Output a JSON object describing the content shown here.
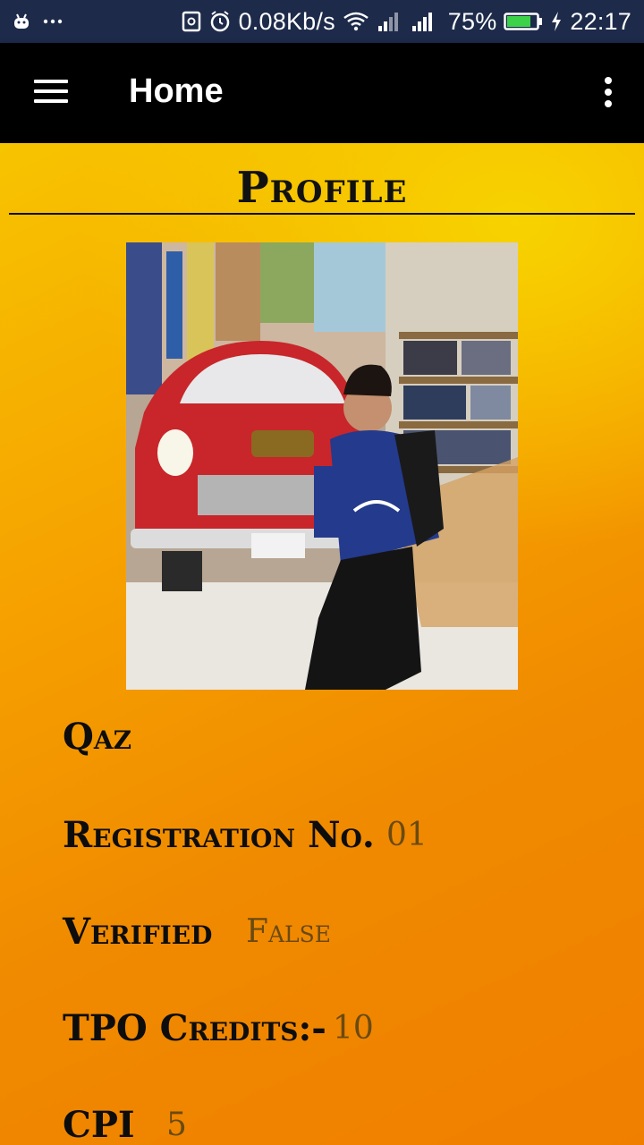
{
  "status_bar": {
    "speed": "0.08Kb/s",
    "battery": "75%",
    "time": "22:17"
  },
  "app_bar": {
    "title": "Home"
  },
  "profile": {
    "section_title": "Profile",
    "name": "Qaz",
    "fields": [
      {
        "label": "Registration No.",
        "value": "01"
      },
      {
        "label": "Verified",
        "value": "False"
      },
      {
        "label": "TPO Credits:-",
        "value": "10"
      },
      {
        "label": "CPI",
        "value": "5"
      }
    ]
  }
}
